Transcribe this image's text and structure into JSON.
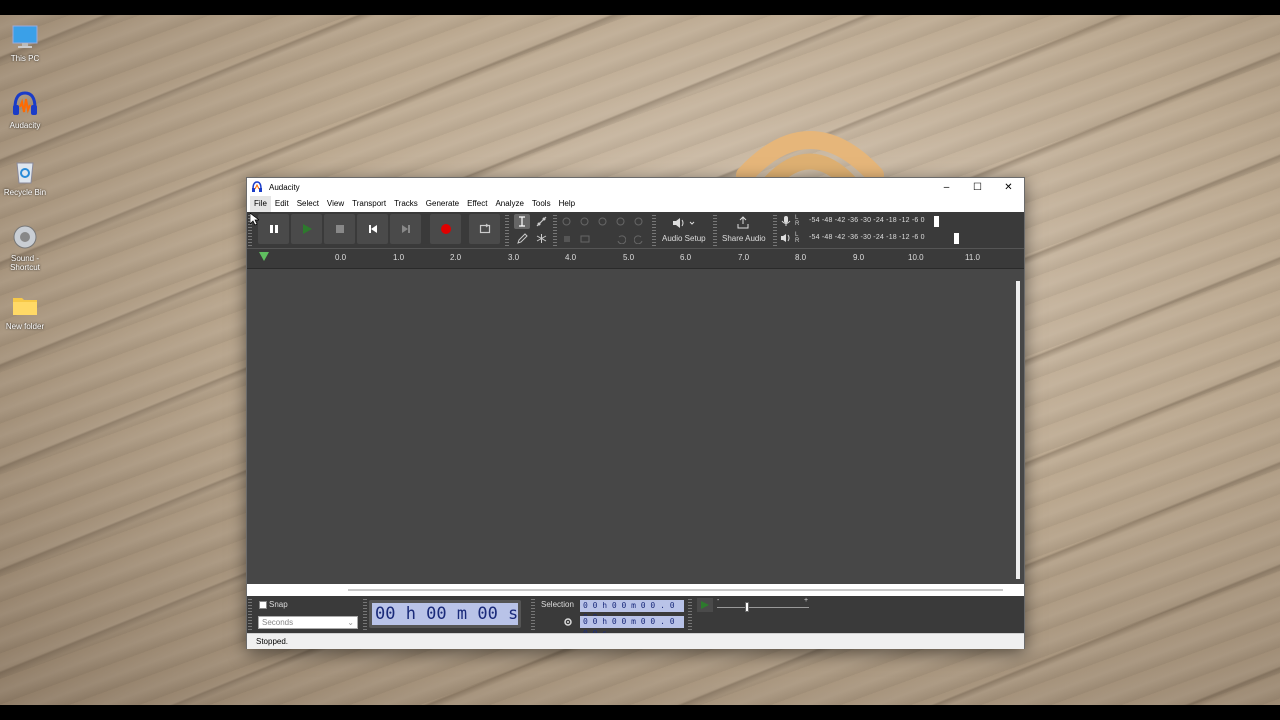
{
  "desktop": {
    "icons": [
      {
        "label": "This PC",
        "icon": "monitor-icon"
      },
      {
        "label": "Audacity",
        "icon": "audacity-icon"
      },
      {
        "label": "Recycle Bin",
        "icon": "recycle-bin-icon"
      },
      {
        "label": "Sound -",
        "label2": "Shortcut",
        "icon": "speaker-icon"
      },
      {
        "label": "New folder",
        "icon": "folder-icon"
      }
    ]
  },
  "window": {
    "title": "Audacity",
    "controls": {
      "minimize": "–",
      "maximize": "☐",
      "close": "✕"
    }
  },
  "menu": [
    "File",
    "Edit",
    "Select",
    "View",
    "Transport",
    "Tracks",
    "Generate",
    "Effect",
    "Analyze",
    "Tools",
    "Help"
  ],
  "toolbar": {
    "audio_setup_label": "Audio Setup",
    "share_audio_label": "Share Audio",
    "record_meter_ticks": "-54 -48 -42 -36 -30 -24 -18 -12 -6   0",
    "playback_meter_ticks": "-54 -48 -42 -36 -30 -24 -18 -12  -6   0",
    "meter_lr": "L\nR",
    "colors": {
      "record": "#e00000",
      "play": "#2d7a2d"
    }
  },
  "ruler": {
    "ticks": [
      "0.0",
      "1.0",
      "2.0",
      "3.0",
      "4.0",
      "5.0",
      "6.0",
      "7.0",
      "8.0",
      "9.0",
      "10.0",
      "11.0"
    ]
  },
  "bottom": {
    "snap_label": "Snap",
    "snap_checked": false,
    "snap_unit": "Seconds",
    "time_display": "00 h 00 m 00 s",
    "selection_label": "Selection",
    "selection_start": "0 0 h 0 0 m 0 0 . 0 0 0 s",
    "selection_end": "0 0 h 0 0 m 0 0 . 0 0 0 s",
    "speed_minus": "-",
    "speed_plus": "+"
  },
  "status": {
    "text": "Stopped."
  }
}
